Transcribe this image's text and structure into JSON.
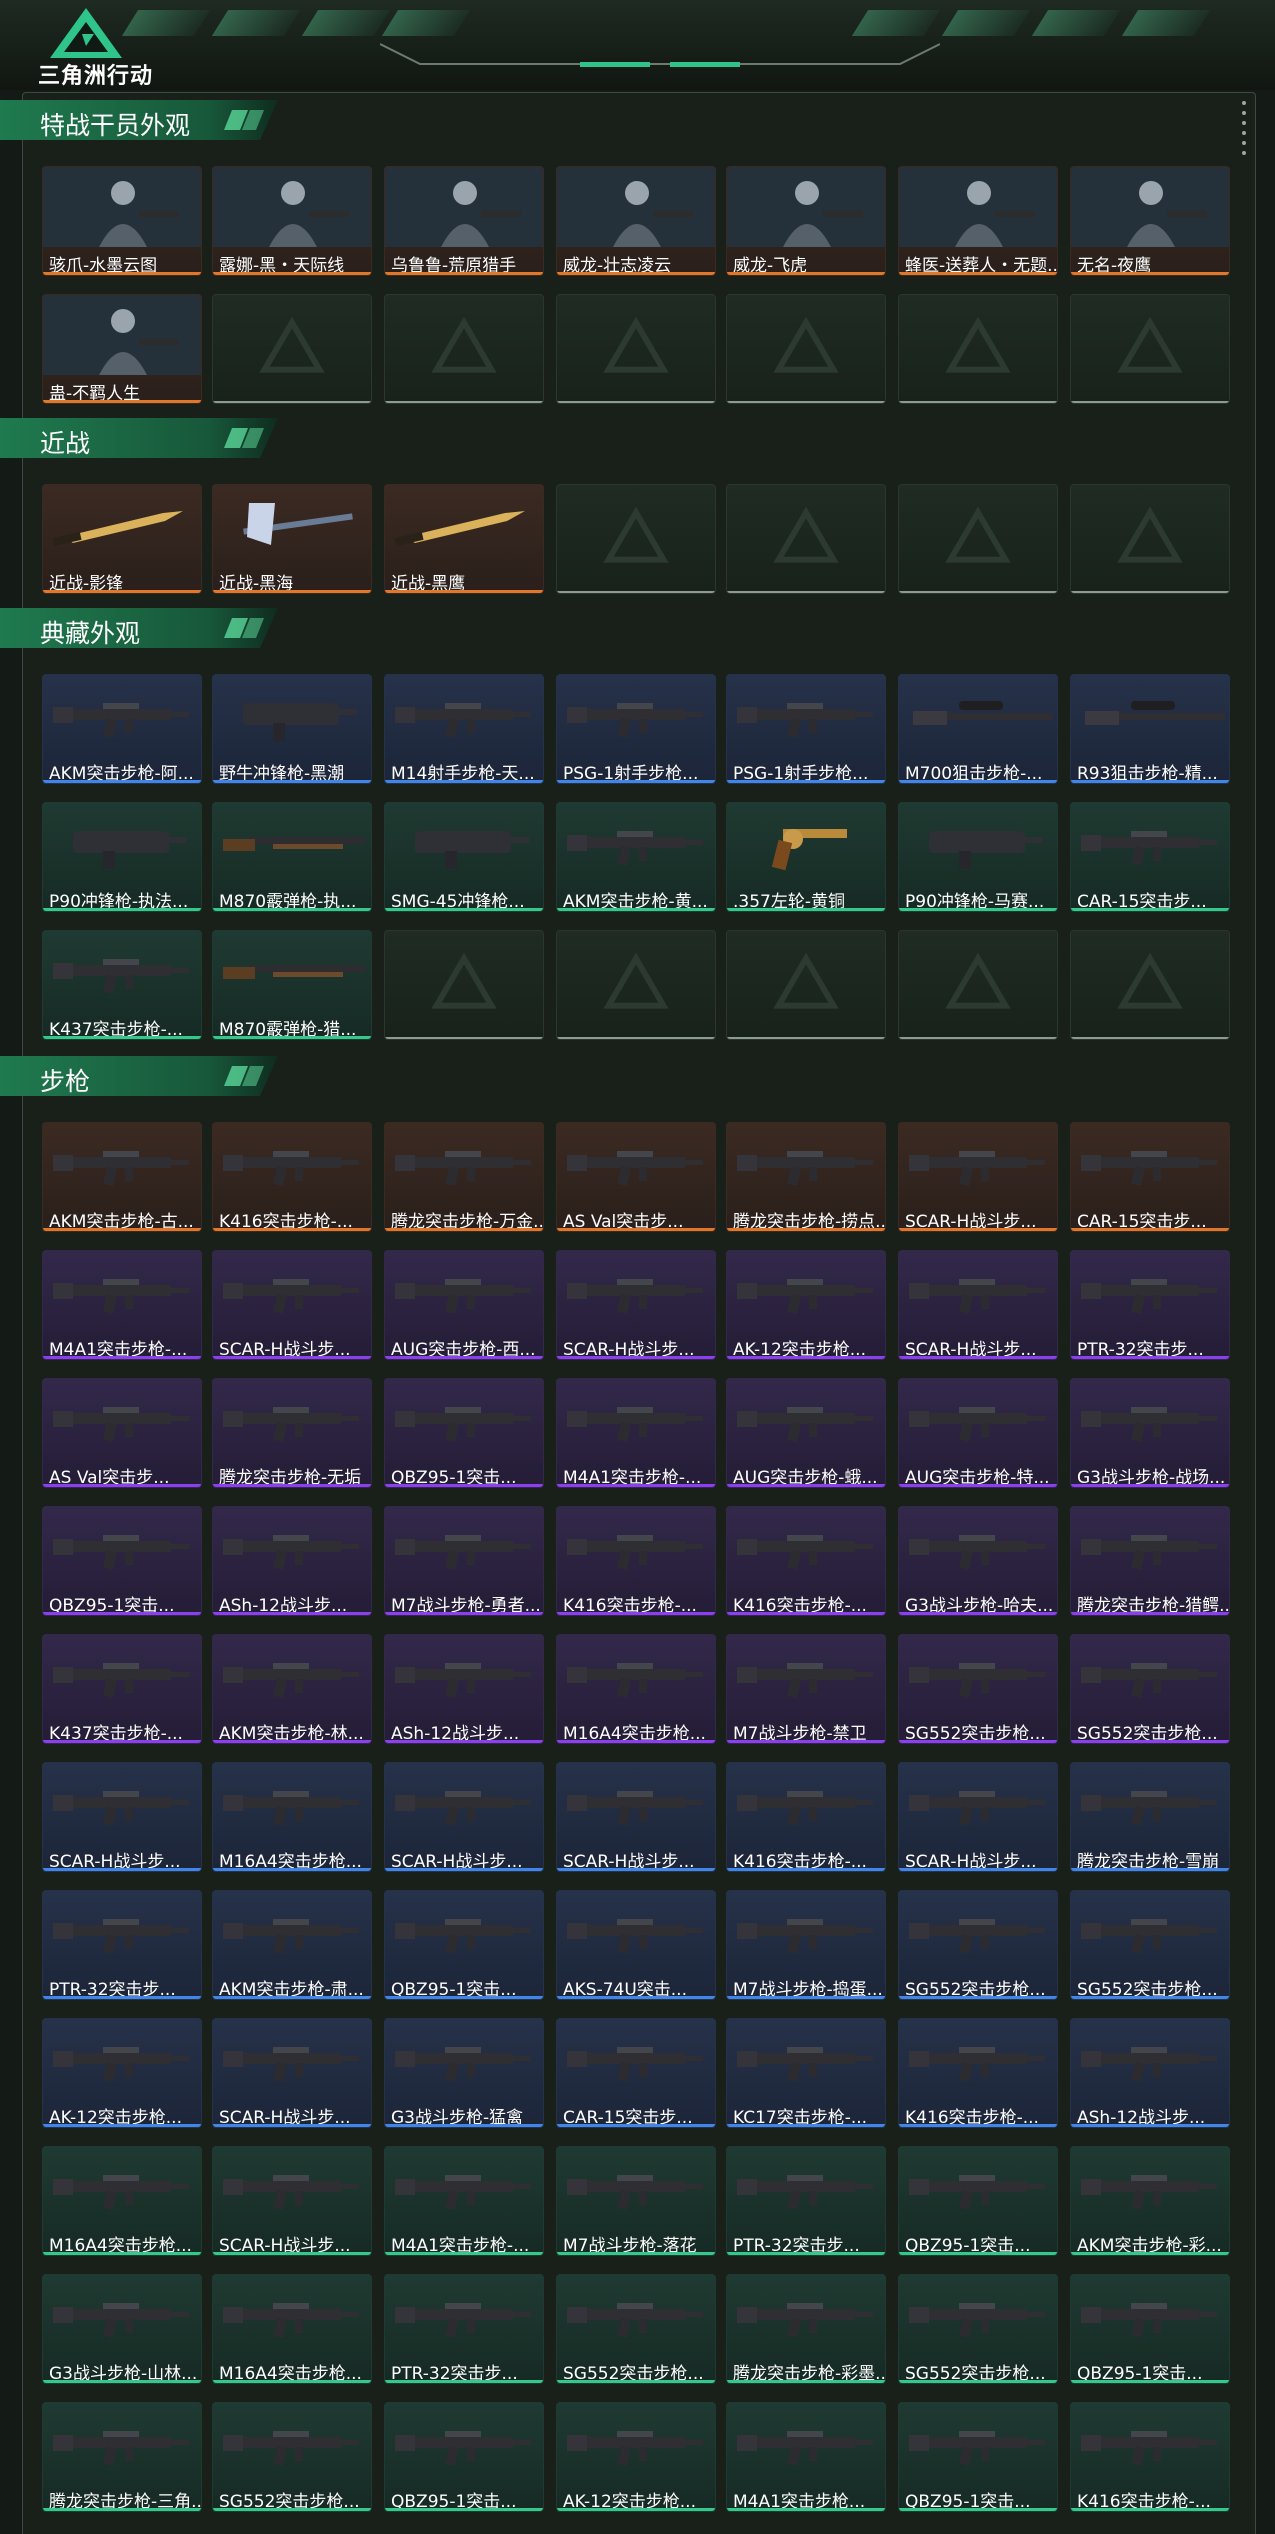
{
  "header": {
    "logo_text": "三角洲行动"
  },
  "colors": {
    "orange": "#e0772b",
    "blue": "#3f86e8",
    "purple": "#8b3ff0",
    "green": "#32c98a",
    "empty": "#8c9a92"
  },
  "sections": [
    {
      "title": "特战干员外观",
      "items": [
        {
          "label": "骇爪-水墨云图",
          "rarity": "orange",
          "icon": "operator-portrait"
        },
        {
          "label": "露娜-黑・天际线",
          "rarity": "orange",
          "icon": "operator-portrait"
        },
        {
          "label": "乌鲁鲁-荒原猎手",
          "rarity": "orange",
          "icon": "operator-portrait"
        },
        {
          "label": "威龙-壮志凌云",
          "rarity": "orange",
          "icon": "operator-portrait"
        },
        {
          "label": "威龙-飞虎",
          "rarity": "orange",
          "icon": "operator-portrait"
        },
        {
          "label": "蜂医-送葬人・无题...",
          "rarity": "orange",
          "icon": "operator-portrait"
        },
        {
          "label": "无名-夜鹰",
          "rarity": "orange",
          "icon": "operator-portrait"
        },
        {
          "label": "蛊-不羁人生",
          "rarity": "orange",
          "icon": "operator-portrait"
        }
      ],
      "empty_slots": 6
    },
    {
      "title": "近战",
      "items": [
        {
          "label": "近战-影锋",
          "rarity": "orange",
          "icon": "knife"
        },
        {
          "label": "近战-黑海",
          "rarity": "orange",
          "icon": "axe"
        },
        {
          "label": "近战-黑鹰",
          "rarity": "orange",
          "icon": "knife"
        }
      ],
      "empty_slots": 4
    },
    {
      "title": "典藏外观",
      "items": [
        {
          "label": "AKM突击步枪-阿...",
          "rarity": "blue",
          "icon": "rifle"
        },
        {
          "label": "野牛冲锋枪-黑潮",
          "rarity": "blue",
          "icon": "smg"
        },
        {
          "label": "M14射手步枪-天...",
          "rarity": "blue",
          "icon": "rifle"
        },
        {
          "label": "PSG-1射手步枪...",
          "rarity": "blue",
          "icon": "rifle"
        },
        {
          "label": "PSG-1射手步枪...",
          "rarity": "blue",
          "icon": "rifle"
        },
        {
          "label": "M700狙击步枪-...",
          "rarity": "blue",
          "icon": "sniper"
        },
        {
          "label": "R93狙击步枪-精...",
          "rarity": "blue",
          "icon": "sniper"
        },
        {
          "label": "P90冲锋枪-执法...",
          "rarity": "green",
          "icon": "smg"
        },
        {
          "label": "M870霰弹枪-执...",
          "rarity": "green",
          "icon": "shotgun"
        },
        {
          "label": "SMG-45冲锋枪...",
          "rarity": "green",
          "icon": "smg"
        },
        {
          "label": "AKM突击步枪-黄...",
          "rarity": "green",
          "icon": "rifle"
        },
        {
          "label": ".357左轮-黄铜",
          "rarity": "green",
          "icon": "revolver"
        },
        {
          "label": "P90冲锋枪-马赛...",
          "rarity": "green",
          "icon": "smg"
        },
        {
          "label": "CAR-15突击步...",
          "rarity": "green",
          "icon": "rifle"
        },
        {
          "label": "K437突击步枪-...",
          "rarity": "green",
          "icon": "rifle"
        },
        {
          "label": "M870霰弹枪-猎...",
          "rarity": "green",
          "icon": "shotgun"
        }
      ],
      "empty_slots": 5
    },
    {
      "title": "步枪",
      "items": [
        {
          "label": "AKM突击步枪-古...",
          "rarity": "orange",
          "icon": "rifle"
        },
        {
          "label": "K416突击步枪-...",
          "rarity": "orange",
          "icon": "rifle"
        },
        {
          "label": "腾龙突击步枪-万金...",
          "rarity": "orange",
          "icon": "rifle"
        },
        {
          "label": "AS Val突击步...",
          "rarity": "orange",
          "icon": "rifle"
        },
        {
          "label": "腾龙突击步枪-捞点...",
          "rarity": "orange",
          "icon": "rifle"
        },
        {
          "label": "SCAR-H战斗步...",
          "rarity": "orange",
          "icon": "rifle"
        },
        {
          "label": "CAR-15突击步...",
          "rarity": "orange",
          "icon": "rifle"
        },
        {
          "label": "M4A1突击步枪-...",
          "rarity": "purple",
          "icon": "rifle"
        },
        {
          "label": "SCAR-H战斗步...",
          "rarity": "purple",
          "icon": "rifle"
        },
        {
          "label": "AUG突击步枪-西...",
          "rarity": "purple",
          "icon": "rifle"
        },
        {
          "label": "SCAR-H战斗步...",
          "rarity": "purple",
          "icon": "rifle"
        },
        {
          "label": "AK-12突击步枪...",
          "rarity": "purple",
          "icon": "rifle"
        },
        {
          "label": "SCAR-H战斗步...",
          "rarity": "purple",
          "icon": "rifle"
        },
        {
          "label": "PTR-32突击步...",
          "rarity": "purple",
          "icon": "rifle"
        },
        {
          "label": "AS Val突击步...",
          "rarity": "purple",
          "icon": "rifle"
        },
        {
          "label": "腾龙突击步枪-无垢",
          "rarity": "purple",
          "icon": "rifle"
        },
        {
          "label": "QBZ95-1突击...",
          "rarity": "purple",
          "icon": "rifle"
        },
        {
          "label": "M4A1突击步枪-...",
          "rarity": "purple",
          "icon": "rifle"
        },
        {
          "label": "AUG突击步枪-蛾...",
          "rarity": "purple",
          "icon": "rifle"
        },
        {
          "label": "AUG突击步枪-特...",
          "rarity": "purple",
          "icon": "rifle"
        },
        {
          "label": "G3战斗步枪-战场...",
          "rarity": "purple",
          "icon": "rifle"
        },
        {
          "label": "QBZ95-1突击...",
          "rarity": "purple",
          "icon": "rifle"
        },
        {
          "label": "ASh-12战斗步...",
          "rarity": "purple",
          "icon": "rifle"
        },
        {
          "label": "M7战斗步枪-勇者...",
          "rarity": "purple",
          "icon": "rifle"
        },
        {
          "label": "K416突击步枪-...",
          "rarity": "purple",
          "icon": "rifle"
        },
        {
          "label": "K416突击步枪-...",
          "rarity": "purple",
          "icon": "rifle"
        },
        {
          "label": "G3战斗步枪-哈夫...",
          "rarity": "purple",
          "icon": "rifle"
        },
        {
          "label": "腾龙突击步枪-猎鳄...",
          "rarity": "purple",
          "icon": "rifle"
        },
        {
          "label": "K437突击步枪-...",
          "rarity": "purple",
          "icon": "rifle"
        },
        {
          "label": "AKM突击步枪-林...",
          "rarity": "purple",
          "icon": "rifle"
        },
        {
          "label": "ASh-12战斗步...",
          "rarity": "purple",
          "icon": "rifle"
        },
        {
          "label": "M16A4突击步枪...",
          "rarity": "purple",
          "icon": "rifle"
        },
        {
          "label": "M7战斗步枪-禁卫",
          "rarity": "purple",
          "icon": "rifle"
        },
        {
          "label": "SG552突击步枪...",
          "rarity": "purple",
          "icon": "rifle"
        },
        {
          "label": "SG552突击步枪...",
          "rarity": "purple",
          "icon": "rifle"
        },
        {
          "label": "SCAR-H战斗步...",
          "rarity": "blue",
          "icon": "rifle"
        },
        {
          "label": "M16A4突击步枪...",
          "rarity": "blue",
          "icon": "rifle"
        },
        {
          "label": "SCAR-H战斗步...",
          "rarity": "blue",
          "icon": "rifle"
        },
        {
          "label": "SCAR-H战斗步...",
          "rarity": "blue",
          "icon": "rifle"
        },
        {
          "label": "K416突击步枪-...",
          "rarity": "blue",
          "icon": "rifle"
        },
        {
          "label": "SCAR-H战斗步...",
          "rarity": "blue",
          "icon": "rifle"
        },
        {
          "label": "腾龙突击步枪-雪崩",
          "rarity": "blue",
          "icon": "rifle"
        },
        {
          "label": "PTR-32突击步...",
          "rarity": "blue",
          "icon": "rifle"
        },
        {
          "label": "AKM突击步枪-肃...",
          "rarity": "blue",
          "icon": "rifle"
        },
        {
          "label": "QBZ95-1突击...",
          "rarity": "blue",
          "icon": "rifle"
        },
        {
          "label": "AKS-74U突击...",
          "rarity": "blue",
          "icon": "rifle"
        },
        {
          "label": "M7战斗步枪-捣蛋...",
          "rarity": "blue",
          "icon": "rifle"
        },
        {
          "label": "SG552突击步枪...",
          "rarity": "blue",
          "icon": "rifle"
        },
        {
          "label": "SG552突击步枪...",
          "rarity": "blue",
          "icon": "rifle"
        },
        {
          "label": "AK-12突击步枪...",
          "rarity": "blue",
          "icon": "rifle"
        },
        {
          "label": "SCAR-H战斗步...",
          "rarity": "blue",
          "icon": "rifle"
        },
        {
          "label": "G3战斗步枪-猛禽",
          "rarity": "blue",
          "icon": "rifle"
        },
        {
          "label": "CAR-15突击步...",
          "rarity": "blue",
          "icon": "rifle"
        },
        {
          "label": "KC17突击步枪-...",
          "rarity": "blue",
          "icon": "rifle"
        },
        {
          "label": "K416突击步枪-...",
          "rarity": "blue",
          "icon": "rifle"
        },
        {
          "label": "ASh-12战斗步...",
          "rarity": "blue",
          "icon": "rifle"
        },
        {
          "label": "M16A4突击步枪...",
          "rarity": "green",
          "icon": "rifle"
        },
        {
          "label": "SCAR-H战斗步...",
          "rarity": "green",
          "icon": "rifle"
        },
        {
          "label": "M4A1突击步枪-...",
          "rarity": "green",
          "icon": "rifle"
        },
        {
          "label": "M7战斗步枪-落花",
          "rarity": "green",
          "icon": "rifle"
        },
        {
          "label": "PTR-32突击步...",
          "rarity": "green",
          "icon": "rifle"
        },
        {
          "label": "QBZ95-1突击...",
          "rarity": "green",
          "icon": "rifle"
        },
        {
          "label": "AKM突击步枪-彩...",
          "rarity": "green",
          "icon": "rifle"
        },
        {
          "label": "G3战斗步枪-山林...",
          "rarity": "green",
          "icon": "rifle"
        },
        {
          "label": "M16A4突击步枪...",
          "rarity": "green",
          "icon": "rifle"
        },
        {
          "label": "PTR-32突击步...",
          "rarity": "green",
          "icon": "rifle"
        },
        {
          "label": "SG552突击步枪...",
          "rarity": "green",
          "icon": "rifle"
        },
        {
          "label": "腾龙突击步枪-彩墨...",
          "rarity": "green",
          "icon": "rifle"
        },
        {
          "label": "SG552突击步枪...",
          "rarity": "green",
          "icon": "rifle"
        },
        {
          "label": "QBZ95-1突击...",
          "rarity": "green",
          "icon": "rifle"
        },
        {
          "label": "腾龙突击步枪-三角...",
          "rarity": "green",
          "icon": "rifle"
        },
        {
          "label": "SG552突击步枪...",
          "rarity": "green",
          "icon": "rifle"
        },
        {
          "label": "QBZ95-1突击...",
          "rarity": "green",
          "icon": "rifle"
        },
        {
          "label": "AK-12突击步枪...",
          "rarity": "green",
          "icon": "rifle"
        },
        {
          "label": "M4A1突击步枪...",
          "rarity": "green",
          "icon": "rifle"
        },
        {
          "label": "QBZ95-1突击...",
          "rarity": "green",
          "icon": "rifle"
        },
        {
          "label": "K416突击步枪-...",
          "rarity": "green",
          "icon": "rifle"
        }
      ],
      "empty_slots": 0
    }
  ]
}
